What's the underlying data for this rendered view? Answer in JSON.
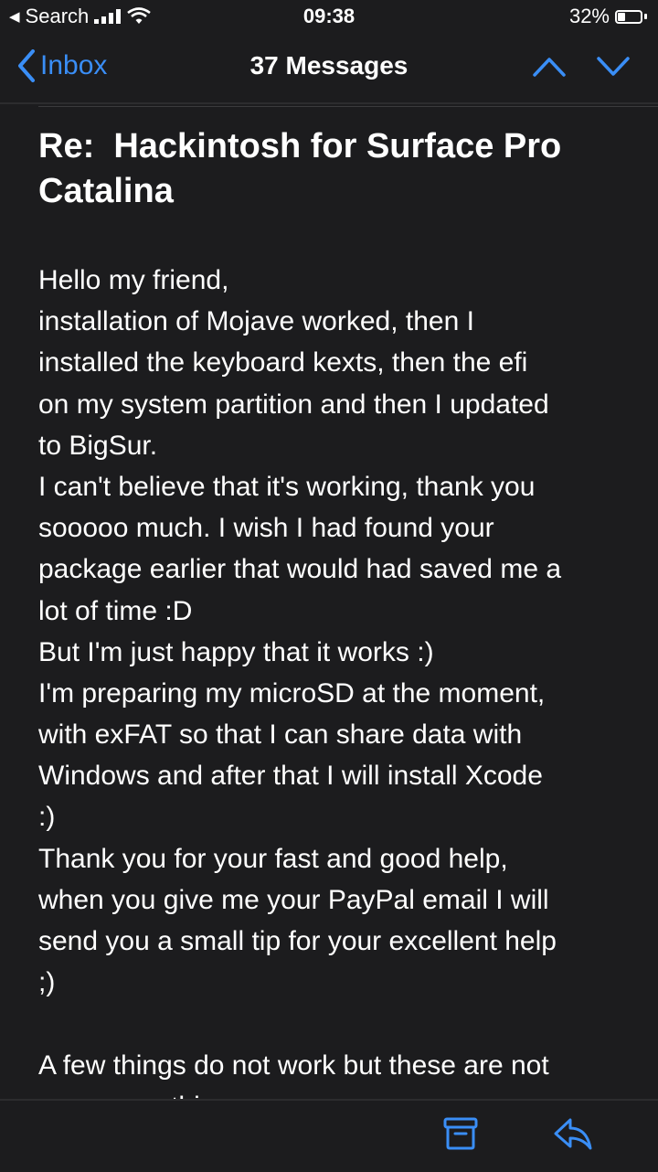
{
  "status_bar": {
    "back_app": "Search",
    "time": "09:38",
    "battery_percent": "32%",
    "battery_level": 0.32
  },
  "nav": {
    "back_label": "Inbox",
    "title": "37 Messages"
  },
  "email": {
    "subject": "Re:  Hackintosh for Surface Pro\nCatalina",
    "body_lines": [
      "Hello my friend,",
      "installation of Mojave worked, then I",
      "installed the keyboard kexts, then the efi",
      "on my system partition and then I updated",
      "to BigSur.",
      "I can't believe that it's working, thank you",
      "sooooo much. I wish I had found your",
      "package earlier that would had saved me a",
      "lot of time :D",
      "But I'm just happy that it works :)",
      "I'm preparing my microSD at the moment,",
      "with exFAT so that I can share data with",
      "Windows and after that I will install Xcode",
      ":)",
      "Thank you for your fast and good help,",
      "when you give me your PayPal email I will",
      "send you a small tip for your excellent help",
      ";)",
      "",
      "A few things do not work but these are not",
      "necessary things"
    ]
  },
  "colors": {
    "background": "#1c1c1e",
    "accent": "#3a8ef6",
    "text": "#ffffff"
  },
  "icons": {
    "back": "chevron-left-icon",
    "previous": "chevron-up-icon",
    "next": "chevron-down-icon",
    "archive": "archive-box-icon",
    "reply": "reply-arrow-icon",
    "signal": "signal-bars-icon",
    "wifi": "wifi-icon",
    "battery": "battery-icon"
  }
}
